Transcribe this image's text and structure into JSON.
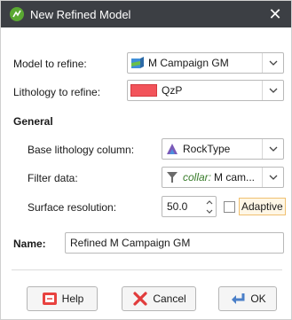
{
  "dialog": {
    "title": "New Refined Model",
    "close_glyph": "✕"
  },
  "fields": {
    "model_label": "Model to refine:",
    "model_value": "M Campaign GM",
    "lithology_label": "Lithology to refine:",
    "lithology_value": "QzP",
    "lithology_color": "#f2545b"
  },
  "general": {
    "heading": "General",
    "base_label": "Base lithology column:",
    "base_value": "RockType",
    "filter_label": "Filter data:",
    "filter_name": "collar:",
    "filter_value": "M cam...",
    "surface_label": "Surface resolution:",
    "surface_value": "50.0",
    "adaptive_label": "Adaptive"
  },
  "name": {
    "label": "Name:",
    "value": "Refined M Campaign GM"
  },
  "buttons": {
    "help": "Help",
    "cancel": "Cancel",
    "ok": "OK"
  }
}
